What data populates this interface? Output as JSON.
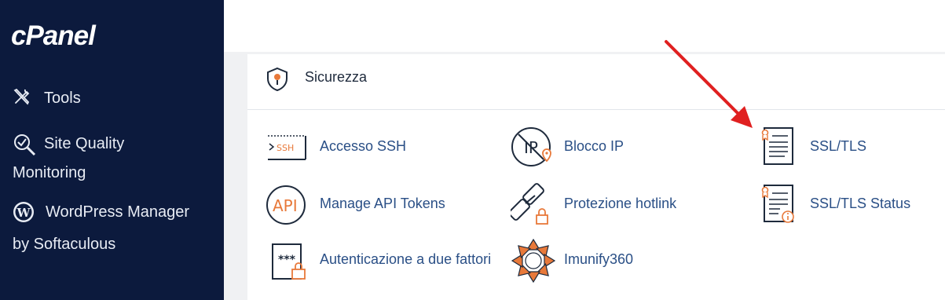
{
  "sidebar": {
    "logo": "cPanel",
    "items": [
      {
        "label": "Tools",
        "icon": "tools-icon"
      },
      {
        "label_line1": "Site Quality",
        "label_line2": "Monitoring",
        "icon": "magnifier-check-icon"
      },
      {
        "label_line1": "WordPress Manager",
        "label_line2": "by Softaculous",
        "icon": "wordpress-icon"
      }
    ]
  },
  "section": {
    "title": "Sicurezza",
    "icon": "shield-icon",
    "items": [
      {
        "label": "Accesso SSH",
        "icon": "ssh-terminal-icon"
      },
      {
        "label": "Blocco IP",
        "icon": "ip-block-icon"
      },
      {
        "label": "SSL/TLS",
        "icon": "certificate-icon"
      },
      {
        "label": "Manage API Tokens",
        "icon": "api-icon"
      },
      {
        "label": "Protezione hotlink",
        "icon": "chain-link-lock-icon"
      },
      {
        "label": "SSL/TLS Status",
        "icon": "certificate-info-icon"
      },
      {
        "label": "Autenticazione a due fattori",
        "icon": "two-factor-lock-icon"
      },
      {
        "label": "Imunify360",
        "icon": "imunify360-icon"
      }
    ]
  },
  "colors": {
    "sidebar_bg": "#0c1a3d",
    "link": "#2a4f86",
    "accent_orange": "#e8793a",
    "annotation_arrow": "#e02020"
  }
}
